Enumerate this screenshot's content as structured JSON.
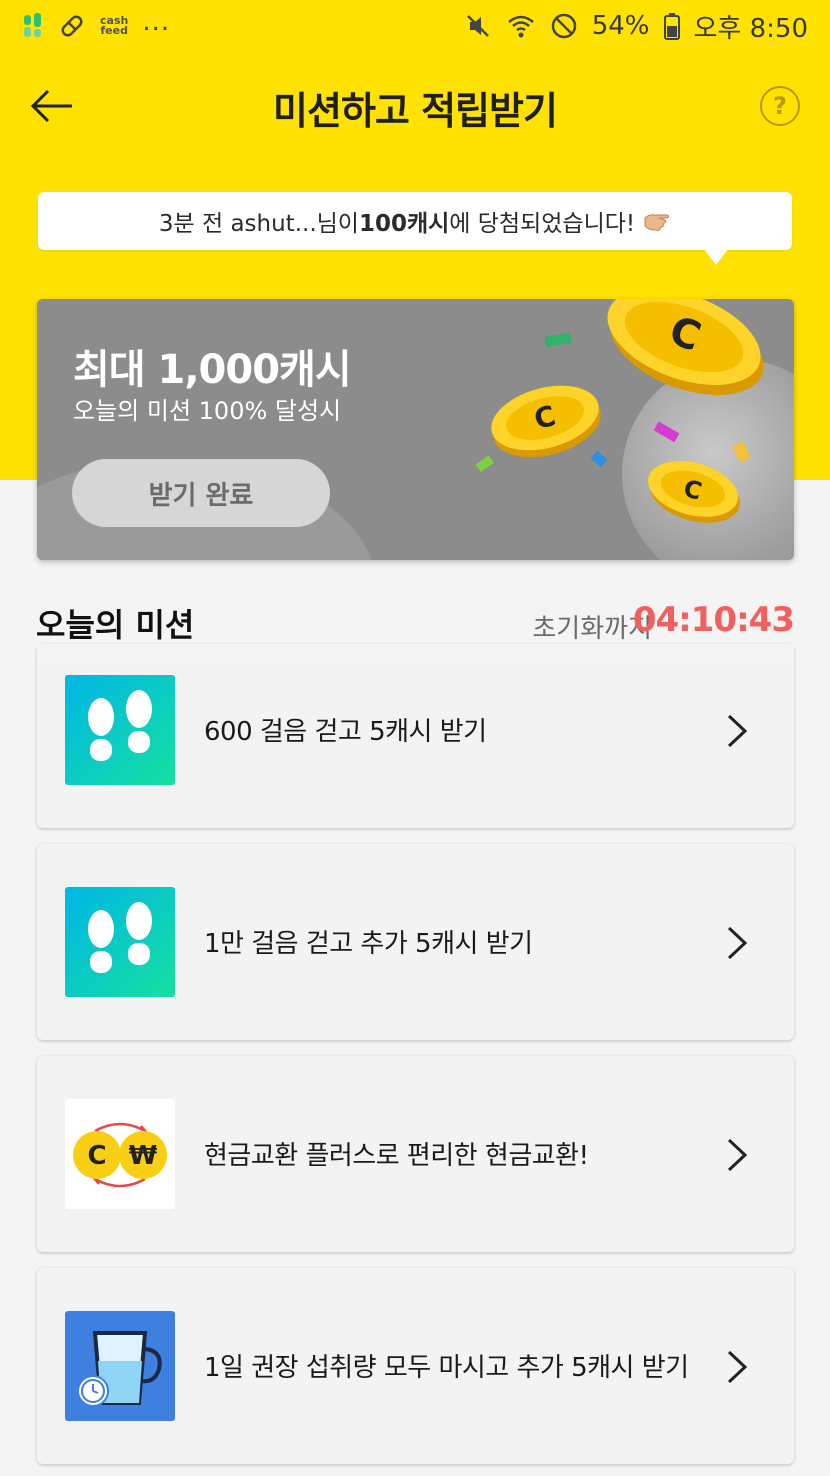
{
  "status_bar": {
    "app_mini_label": "cash\nfeed",
    "more_dots": "...",
    "battery": "54%",
    "time": "오후 8:50"
  },
  "header": {
    "title": "미션하고 적립받기",
    "help_glyph": "?"
  },
  "notice": {
    "prefix": "3분 전 ashut...님이 ",
    "amount": "100캐시",
    "suffix": "에 당첨되었습니다!"
  },
  "promo": {
    "title": "최대 1,000캐시",
    "subtitle": "오늘의 미션 100% 달성시",
    "button_label": "받기 완료"
  },
  "section": {
    "title": "오늘의 미션",
    "reset_label": "초기화까지",
    "reset_time": "04:10:43"
  },
  "missions": [
    {
      "label": "600 걸음 걷고 5캐시 받기",
      "icon": "footsteps-icon"
    },
    {
      "label": "1만 걸음 걷고 추가 5캐시 받기",
      "icon": "footsteps-icon"
    },
    {
      "label": "현금교환 플러스로 편리한 현금교환!",
      "icon": "cash-exchange-icon"
    },
    {
      "label": "1일 권장 섭취량 모두 마시고 추가 5캐시 받기",
      "icon": "water-cup-icon"
    }
  ],
  "colors": {
    "brand_yellow": "#ffe200",
    "timer_red": "#f0605e",
    "promo_gray": "#8c8c8c"
  }
}
